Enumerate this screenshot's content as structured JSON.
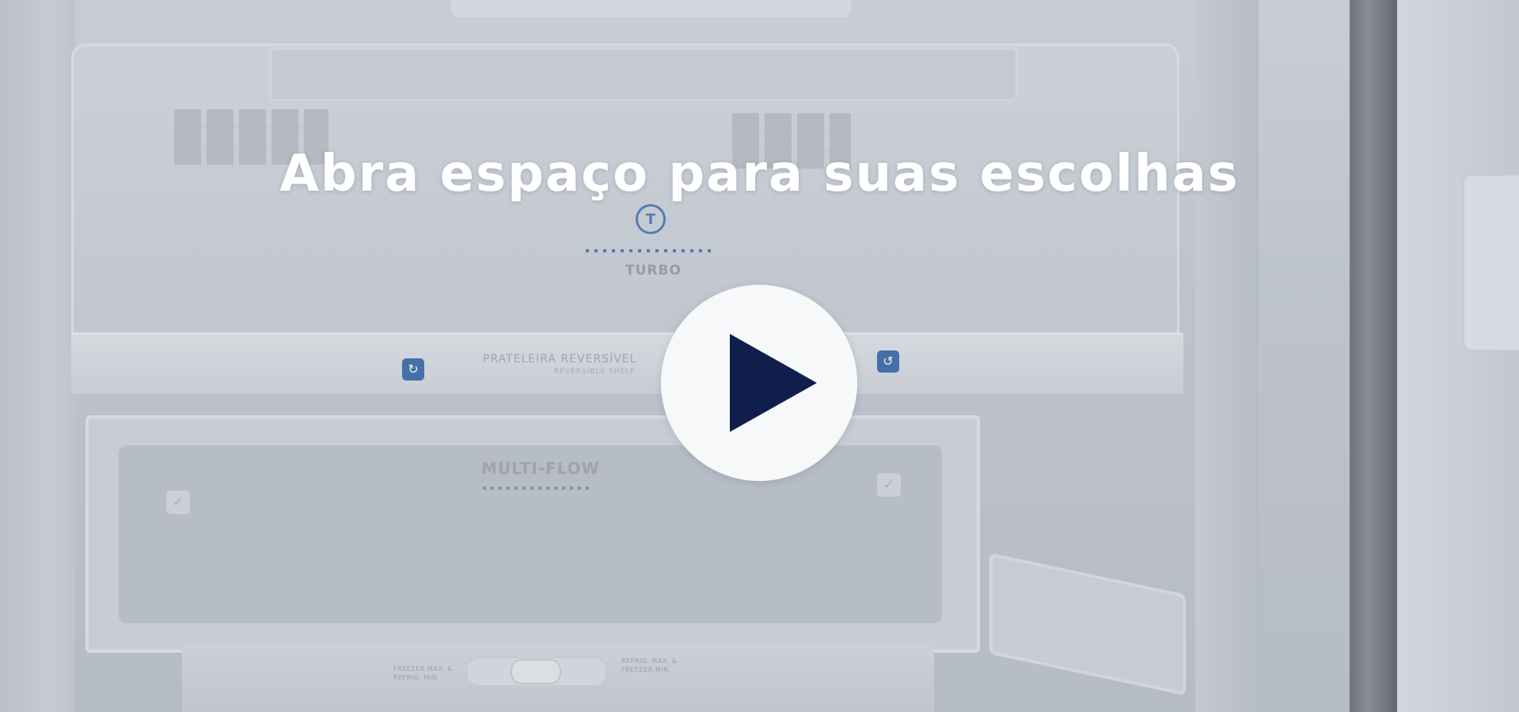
{
  "headline": "Abra espaço para suas escolhas",
  "play_button": {
    "icon": "play-icon",
    "aria_label": "Play video"
  },
  "illustration": {
    "turbo_label": "TURBO",
    "turbo_icon_text": "T",
    "shelf_label": "PRATELEIRA REVERSÍVEL",
    "shelf_sublabel": "REVERSIBLE SHELF",
    "multiflow_label": "MULTI-FLOW",
    "slider_left_text": "FREEZER MAX. & REFRIG. MIN.",
    "slider_right_text": "REFRIG. MAX. & FREEZER MIN."
  },
  "colors": {
    "play_icon": "#0f1e4b",
    "play_button_bg": "#f7f8fa",
    "headline": "#ffffff",
    "accent_badge": "#3d6fa8"
  }
}
